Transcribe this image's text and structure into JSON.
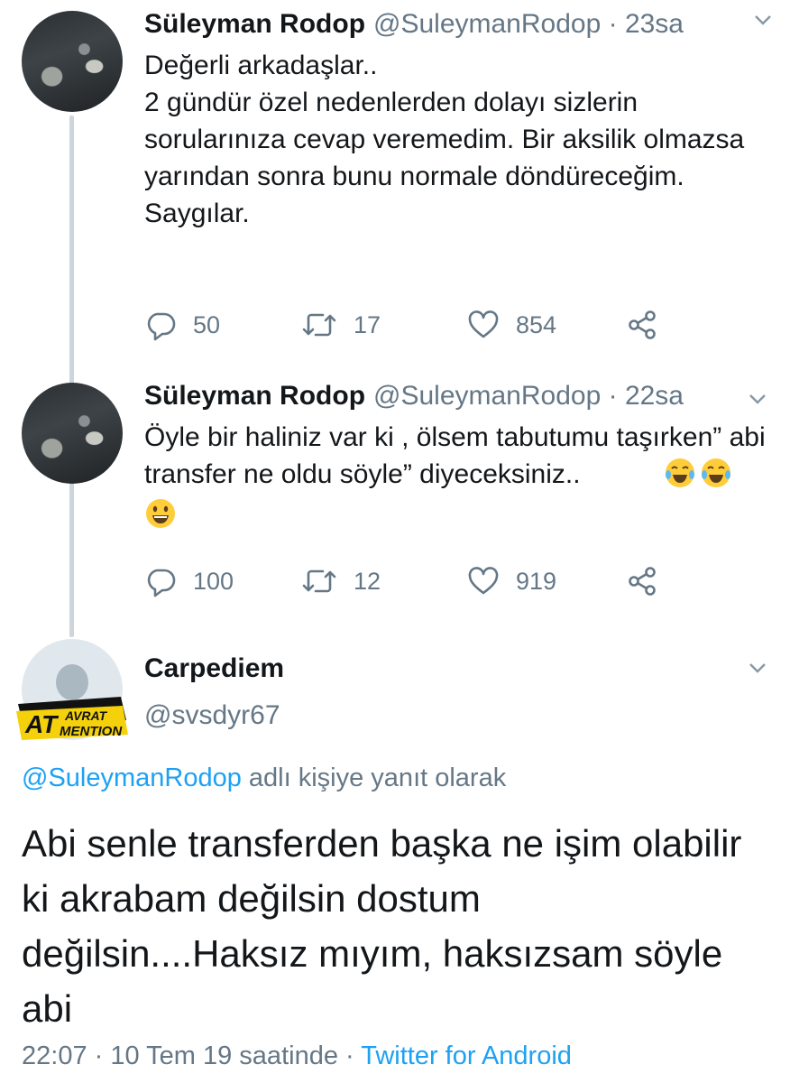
{
  "tweets": [
    {
      "name": "Süleyman Rodop",
      "handle": "@SuleymanRodop",
      "time": "23sa",
      "text": "Değerli arkadaşlar..\n2 gündür özel nedenlerden dolayı sizlerin sorularınıza cevap veremedim. Bir aksilik olmazsa yarından sonra bunu normale döndüreceğim.\nSaygılar.",
      "reply_count": "50",
      "retweet_count": "17",
      "like_count": "854"
    },
    {
      "name": "Süleyman Rodop",
      "handle": "@SuleymanRodop",
      "time": "22sa",
      "text": "Öyle bir haliniz var ki , ölsem tabutumu taşırken” abi transfer ne oldu söyle” diyeceksiniz..",
      "emojis": [
        "face-with-tears-of-joy-emoji",
        "face-with-tears-of-joy-emoji",
        "grinning-face-emoji"
      ],
      "reply_count": "100",
      "retweet_count": "12",
      "like_count": "919"
    }
  ],
  "main_tweet": {
    "name": "Carpediem",
    "handle": "@svsdyr67",
    "badge_text_1": "AVRAT",
    "badge_text_2": "AT",
    "badge_text_3": "MENTION",
    "reply_to_handle": "@SuleymanRodop",
    "reply_to_suffix": "adlı kişiye yanıt olarak",
    "text": "Abi senle transferden başka ne işim olabilir ki akrabam değilsin dostum değilsin....Haksız mıyım, haksızsam söyle abi",
    "time": "22:07",
    "date": "10 Tem 19 saatinde",
    "source": "Twitter for Android"
  },
  "colors": {
    "link": "#1da1f2",
    "secondary_text": "#657786",
    "thread_line": "#cdd6dd"
  }
}
